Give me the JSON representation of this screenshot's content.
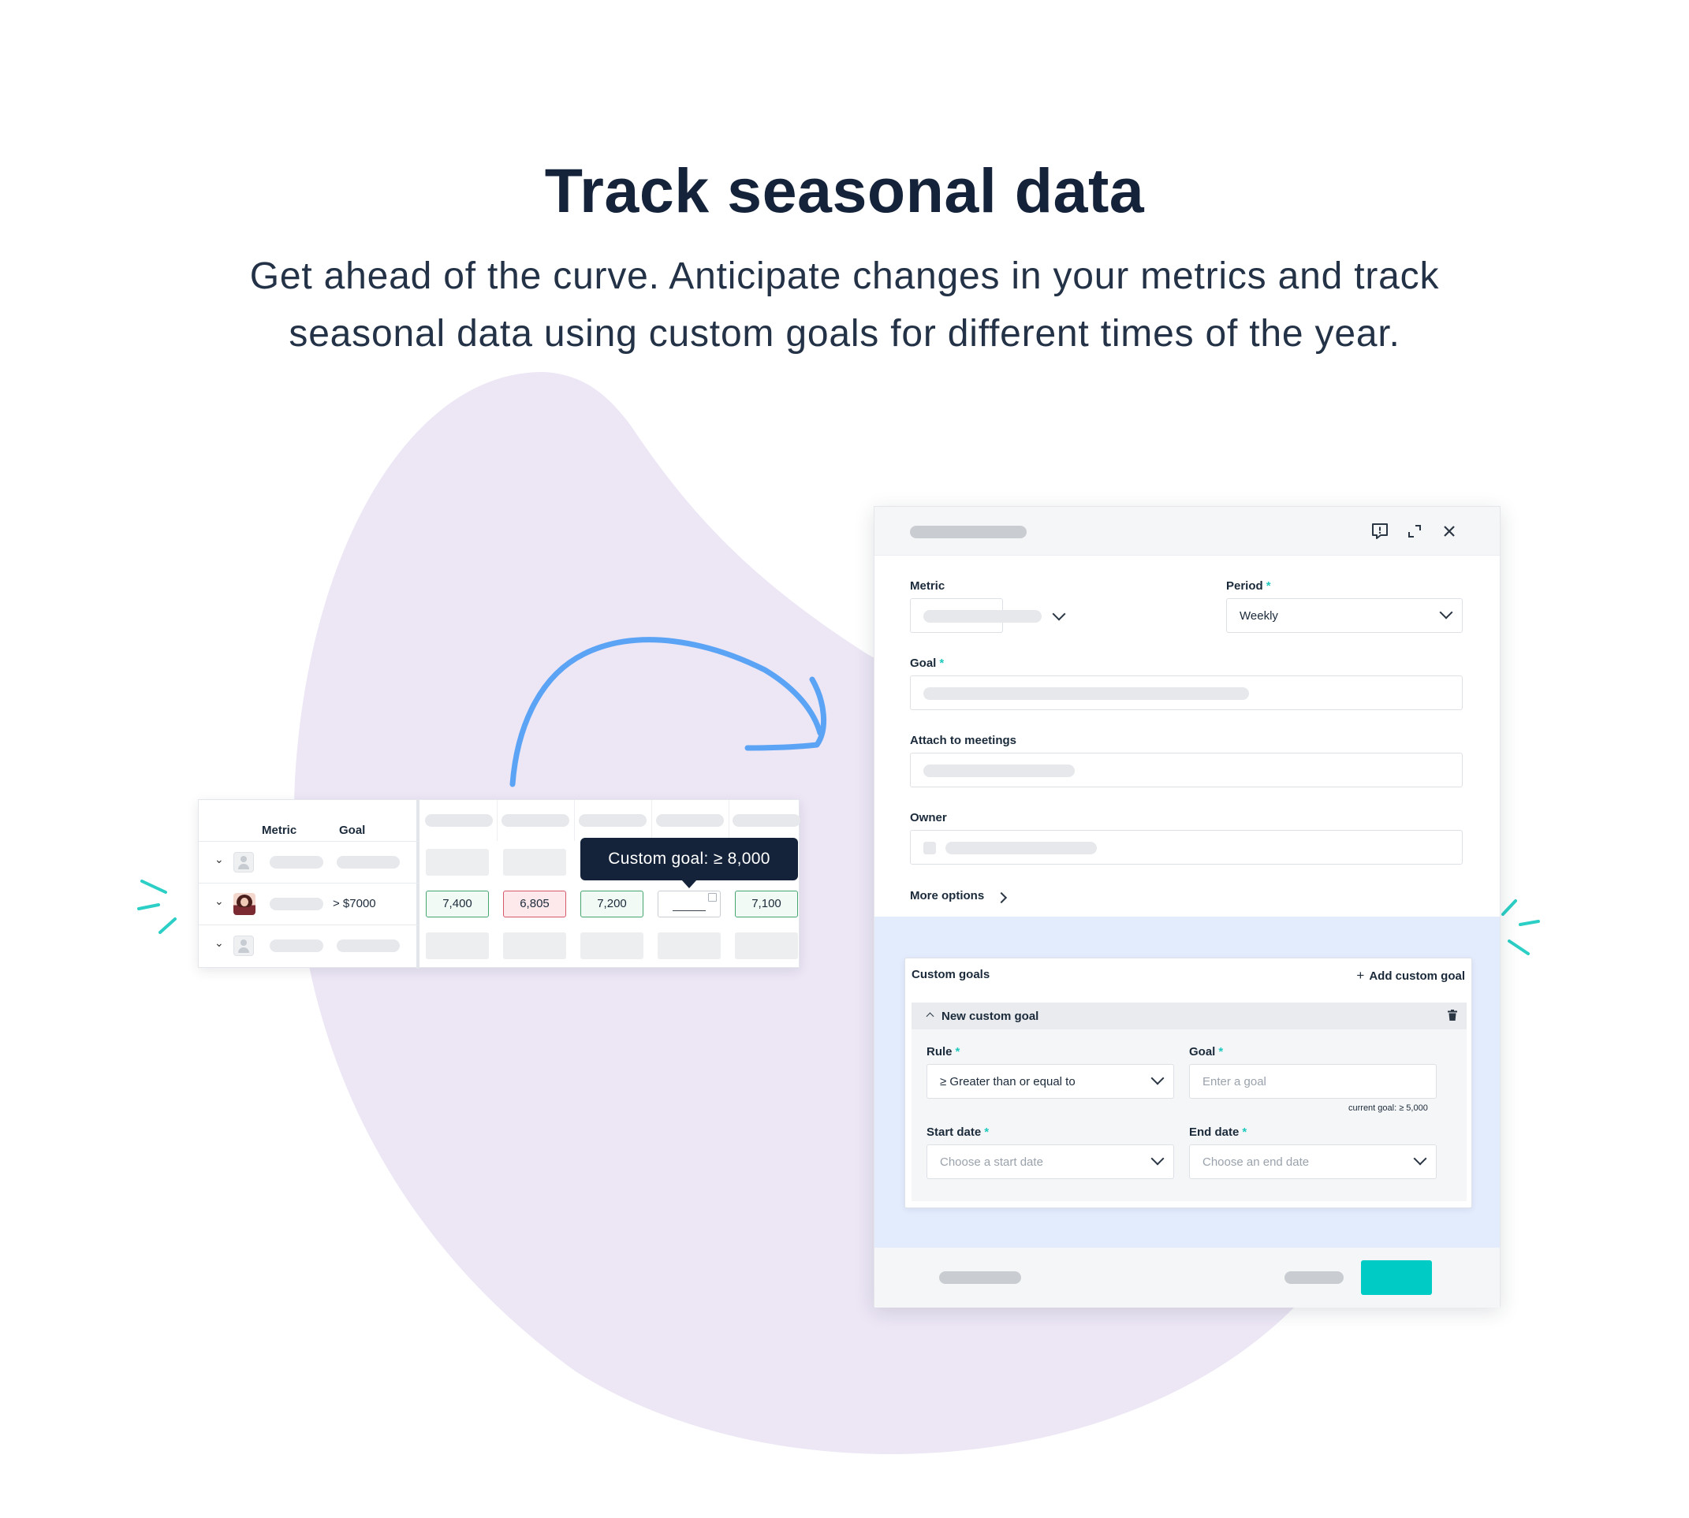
{
  "heading": "Track seasonal data",
  "subheading_line1": "Get ahead of the curve. Anticipate changes in your metrics and track",
  "subheading_line2": "seasonal data using custom goals for different times of the year.",
  "colors": {
    "background": "#ffffff",
    "blob": "#ece6f5",
    "arrow": "#5ba3f5",
    "sparkle": "#2ccfc6",
    "primary_button": "#00cbc5",
    "tooltip": "#15233a"
  },
  "scorecard": {
    "headers": {
      "metric": "Metric",
      "goal": "Goal"
    },
    "rows": [
      {
        "avatar": "placeholder-avatar",
        "goal": ""
      },
      {
        "avatar": "user-photo",
        "goal": "> $7000",
        "cells": [
          "7,400",
          "6,805",
          "7,200",
          "",
          "7,100"
        ],
        "status": [
          "met",
          "missed",
          "met",
          "editing",
          "met"
        ]
      },
      {
        "avatar": "placeholder-avatar",
        "goal": ""
      }
    ],
    "tooltip": "Custom goal: ≥ 8,000"
  },
  "modal": {
    "icons": [
      "feedback-icon",
      "expand-icon",
      "close-icon"
    ],
    "fields": {
      "metric_label": "Metric",
      "period_label": "Period",
      "period_value": "Weekly",
      "goal_label": "Goal",
      "attach_label": "Attach to meetings",
      "owner_label": "Owner",
      "required_mark": "*"
    },
    "more_options": "More options",
    "custom_goals": {
      "title": "Custom goals",
      "add_button": "Add custom goal",
      "new_goal_title": "New custom goal",
      "rule_label": "Rule",
      "rule_value": "≥ Greater than or equal to",
      "goal_label": "Goal",
      "goal_placeholder": "Enter a goal",
      "current_goal_hint": "current goal: ≥ 5,000",
      "start_label": "Start date",
      "start_placeholder": "Choose a start date",
      "end_label": "End date",
      "end_placeholder": "Choose an end date"
    }
  }
}
